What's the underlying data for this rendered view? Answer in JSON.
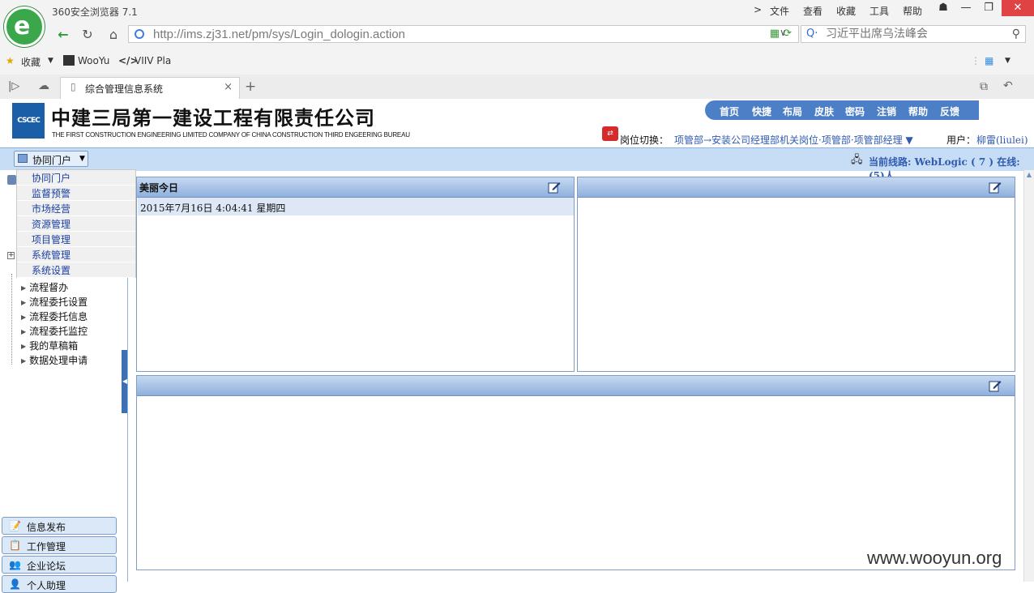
{
  "browser": {
    "app_title": "360安全浏览器 7.1",
    "menu": [
      "文件",
      "查看",
      "收藏",
      "工具",
      "帮助"
    ],
    "window_controls": {
      "shirt": "☗",
      "minimize": "—",
      "maximize": "❐",
      "close": "✕"
    },
    "url": "http://ims.zj31.net/pm/sys/Login_dologin.action",
    "search_placeholder": "习近平出席乌法峰会",
    "bookmarks": {
      "favorites": "收藏",
      "wooyu": "WooYu",
      "viiv": "VIIV Pla"
    },
    "tab_title": "综合管理信息系统"
  },
  "header": {
    "company_name": "中建三局第一建设工程有限责任公司",
    "company_en": "THE FIRST CONSTRUCTION ENGINEERING LIMITED COMPANY OF CHINA CONSTRUCTION THIRD ENGEERING BUREAU",
    "logo_text": "CSCEC",
    "nav": [
      "首页",
      "快捷",
      "布局",
      "皮肤",
      "密码",
      "注销",
      "帮助",
      "反馈"
    ],
    "role_label": "岗位切换：",
    "role_value": "项管部→安装公司经理部机关岗位·项管部·项管部经理 ▼",
    "user_label": "用户：",
    "user_name": "柳雷(liulei)"
  },
  "toolbar": {
    "portal_label": "协同门户",
    "line_status": "当前线路: WebLogic ( 7 ) 在线:(5)人"
  },
  "dropdown": [
    "协同门户",
    "监督预警",
    "市场经营",
    "资源管理",
    "项目管理",
    "系统管理",
    "系统设置"
  ],
  "tree": [
    "流程督办",
    "流程委托设置",
    "流程委托信息",
    "流程委托监控",
    "我的草稿箱",
    "数据处理申请"
  ],
  "sidebar_buttons": [
    {
      "label": "信息发布",
      "icon": "📝"
    },
    {
      "label": "工作管理",
      "icon": "📋"
    },
    {
      "label": "企业论坛",
      "icon": "👥"
    },
    {
      "label": "个人助理",
      "icon": "👤"
    }
  ],
  "panels": {
    "today_title": "美丽今日",
    "today_datetime": "2015年7月16日  4:04:41 星期四"
  },
  "watermark": "www.wooyun.org",
  "colors": {
    "accent_blue": "#4d7fc7",
    "bar_blue": "#c7ddf6",
    "link_blue": "#2f5bb0"
  }
}
